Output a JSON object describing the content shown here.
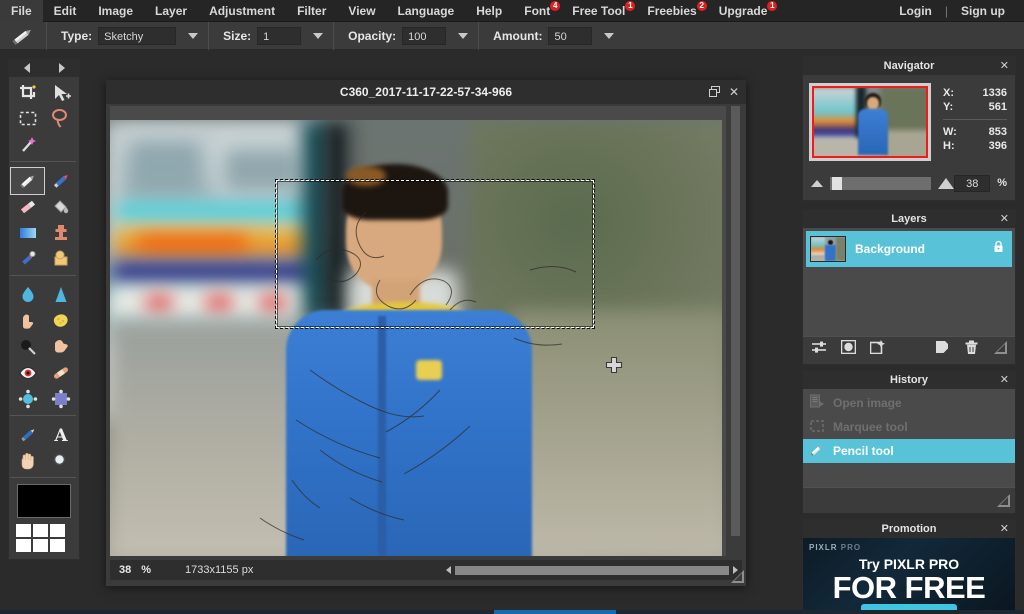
{
  "menubar": {
    "items": [
      {
        "label": "File",
        "badge": null
      },
      {
        "label": "Edit",
        "badge": null
      },
      {
        "label": "Image",
        "badge": null
      },
      {
        "label": "Layer",
        "badge": null
      },
      {
        "label": "Adjustment",
        "badge": null
      },
      {
        "label": "Filter",
        "badge": null
      },
      {
        "label": "View",
        "badge": null
      },
      {
        "label": "Language",
        "badge": null
      },
      {
        "label": "Help",
        "badge": null
      },
      {
        "label": "Font",
        "badge": "4"
      },
      {
        "label": "Free Tool",
        "badge": "1"
      },
      {
        "label": "Freebies",
        "badge": "2"
      },
      {
        "label": "Upgrade",
        "badge": "1"
      }
    ],
    "login": "Login",
    "separator": "|",
    "signup": "Sign up",
    "badge_color": "#e02020"
  },
  "optionsbar": {
    "active_tool_icon": "pencil-icon",
    "type": {
      "label": "Type:",
      "value": "Sketchy"
    },
    "size": {
      "label": "Size:",
      "value": "1"
    },
    "opacity": {
      "label": "Opacity:",
      "value": "100"
    },
    "amount": {
      "label": "Amount:",
      "value": "50"
    }
  },
  "toolbox": {
    "prev_arrow": "arrow-left-icon",
    "next_arrow": "arrow-right-icon",
    "tools": [
      {
        "name": "crop-tool",
        "icon": "crop-icon",
        "selected": false
      },
      {
        "name": "move-tool",
        "icon": "move-arrow-icon",
        "selected": false
      },
      {
        "name": "marquee-tool",
        "icon": "marquee-icon",
        "selected": false
      },
      {
        "name": "lasso-tool",
        "icon": "lasso-icon",
        "selected": false
      },
      {
        "name": "wand-tool",
        "icon": "magic-wand-icon",
        "selected": false
      },
      {
        "name": "pencil-tool",
        "icon": "pencil-icon",
        "selected": true
      },
      {
        "name": "brush-tool",
        "icon": "brush-icon",
        "selected": false
      },
      {
        "name": "eraser-tool",
        "icon": "eraser-icon",
        "selected": false
      },
      {
        "name": "paint-bucket-tool",
        "icon": "paint-bucket-icon",
        "selected": false
      },
      {
        "name": "gradient-tool",
        "icon": "gradient-icon",
        "selected": false
      },
      {
        "name": "clone-stamp-tool",
        "icon": "clone-stamp-icon",
        "selected": false
      },
      {
        "name": "color-replace-tool",
        "icon": "color-replace-icon",
        "selected": false
      },
      {
        "name": "drawing-tool",
        "icon": "shape-draw-icon",
        "selected": false
      },
      {
        "name": "blur-tool",
        "icon": "water-drop-icon",
        "selected": false
      },
      {
        "name": "sharpen-tool",
        "icon": "sharpen-cone-icon",
        "selected": false
      },
      {
        "name": "smudge-tool",
        "icon": "finger-smudge-icon",
        "selected": false
      },
      {
        "name": "sponge-tool",
        "icon": "sponge-icon",
        "selected": false
      },
      {
        "name": "dodge-tool",
        "icon": "dodge-icon",
        "selected": false
      },
      {
        "name": "burn-tool",
        "icon": "burn-hand-icon",
        "selected": false
      },
      {
        "name": "red-eye-tool",
        "icon": "red-eye-icon",
        "selected": false
      },
      {
        "name": "spot-heal-tool",
        "icon": "bandage-icon",
        "selected": false
      },
      {
        "name": "bloat-tool",
        "icon": "bloat-icon",
        "selected": false
      },
      {
        "name": "pinch-tool",
        "icon": "pinch-icon",
        "selected": false
      },
      {
        "name": "color-picker-tool",
        "icon": "eyedropper-icon",
        "selected": false
      },
      {
        "name": "type-tool",
        "icon": "text-a-icon",
        "selected": false
      },
      {
        "name": "hand-tool",
        "icon": "hand-icon",
        "selected": false
      },
      {
        "name": "zoom-tool",
        "icon": "magnifier-icon",
        "selected": false
      }
    ],
    "foreground_color": "#000000",
    "swatch_color": "#ffffff",
    "swatch_count": 6
  },
  "image_window": {
    "title": "C360_2017-11-17-22-57-34-966",
    "restore_icon": "restore-window-icon",
    "close_icon": "close-icon",
    "status": {
      "zoom_value": "38",
      "percent_symbol": "%",
      "dimensions": "1733x1155 px"
    },
    "selection": {
      "visible": true,
      "style": "dashed-marquee"
    },
    "cursor": {
      "icon": "crosshair-cursor-icon"
    }
  },
  "navigator": {
    "title": "Navigator",
    "close_icon": "close-icon",
    "coords": [
      {
        "key": "X:",
        "value": "1336"
      },
      {
        "key": "Y:",
        "value": "561"
      }
    ],
    "size": [
      {
        "key": "W:",
        "value": "853"
      },
      {
        "key": "H:",
        "value": "396"
      }
    ],
    "zoom_value": "38",
    "zoom_unit": "%",
    "zoom_out_icon": "small-mountain-icon",
    "zoom_in_icon": "large-mountain-icon",
    "view_rect_color": "#f01b1b"
  },
  "layers": {
    "title": "Layers",
    "close_icon": "close-icon",
    "selected_color": "#58c3d8",
    "items": [
      {
        "name": "Background",
        "locked": true,
        "selected": true,
        "lock_icon": "lock-icon"
      }
    ],
    "footer_buttons": [
      {
        "name": "layer-settings-button",
        "icon": "sliders-icon"
      },
      {
        "name": "layer-mask-button",
        "icon": "mask-circle-icon"
      },
      {
        "name": "layer-style-button",
        "icon": "layer-style-icon"
      },
      {
        "name": "new-layer-button",
        "icon": "new-layer-icon"
      },
      {
        "name": "delete-layer-button",
        "icon": "trash-icon"
      },
      {
        "name": "resize-panel-button",
        "icon": "resize-grip-icon"
      }
    ]
  },
  "history": {
    "title": "History",
    "close_icon": "close-icon",
    "selected_color": "#58c3d8",
    "items": [
      {
        "label": "Open image",
        "icon": "open-image-icon",
        "active": false
      },
      {
        "label": "Marquee tool",
        "icon": "marquee-icon",
        "active": false
      },
      {
        "label": "Pencil tool",
        "icon": "pencil-icon",
        "active": true
      }
    ],
    "resize_icon": "resize-grip-icon"
  },
  "promotion": {
    "title": "Promotion",
    "close_icon": "close-icon",
    "brand": "PIXLR",
    "brand_suffix": "PRO",
    "line1": "Try PIXLR PRO",
    "line2": "FOR FREE",
    "button_color": "#3ec6e0"
  }
}
